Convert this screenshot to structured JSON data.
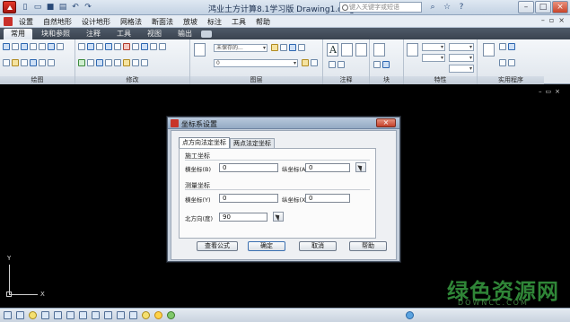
{
  "window": {
    "title": "鸿业土方计算8.1学习版  Drawing1.dwg",
    "search_placeholder": "键入关键字或短语"
  },
  "menu": {
    "items": [
      "设置",
      "自然地形",
      "设计地形",
      "网格法",
      "断面法",
      "放坡",
      "标注",
      "工具",
      "帮助"
    ]
  },
  "ribbon": {
    "tabs": [
      "常用",
      "块和参照",
      "注释",
      "工具",
      "视图",
      "输出"
    ],
    "active_tab": "常用",
    "panels": [
      "绘图",
      "修改",
      "图层",
      "注释",
      "块",
      "特性",
      "实用程序"
    ],
    "layer_combo": "未保存的...",
    "layer_combo2": "0"
  },
  "canvas": {
    "ucs_x": "X",
    "ucs_y": "Y"
  },
  "dialog": {
    "title": "坐标系设置",
    "close": "×",
    "tabs": [
      "点方向法定坐标",
      "两点法定坐标"
    ],
    "active_tab": "点方向法定坐标",
    "construction": {
      "title": "施工坐标",
      "x_label": "横坐标(B)",
      "x_value": "0",
      "y_label": "纵坐标(A)",
      "y_value": "0"
    },
    "survey": {
      "title": "测量坐标",
      "x_label": "横坐标(Y)",
      "x_value": "0",
      "y_label": "纵坐标(X)",
      "y_value": "0"
    },
    "north_label": "北方向(度)",
    "north_value": "90",
    "buttons": {
      "view_formula": "查看公式",
      "ok": "确定",
      "cancel": "取消",
      "help": "帮助"
    }
  },
  "watermark": {
    "main": "绿色资源网",
    "sub": "DOWNCC.COM"
  }
}
